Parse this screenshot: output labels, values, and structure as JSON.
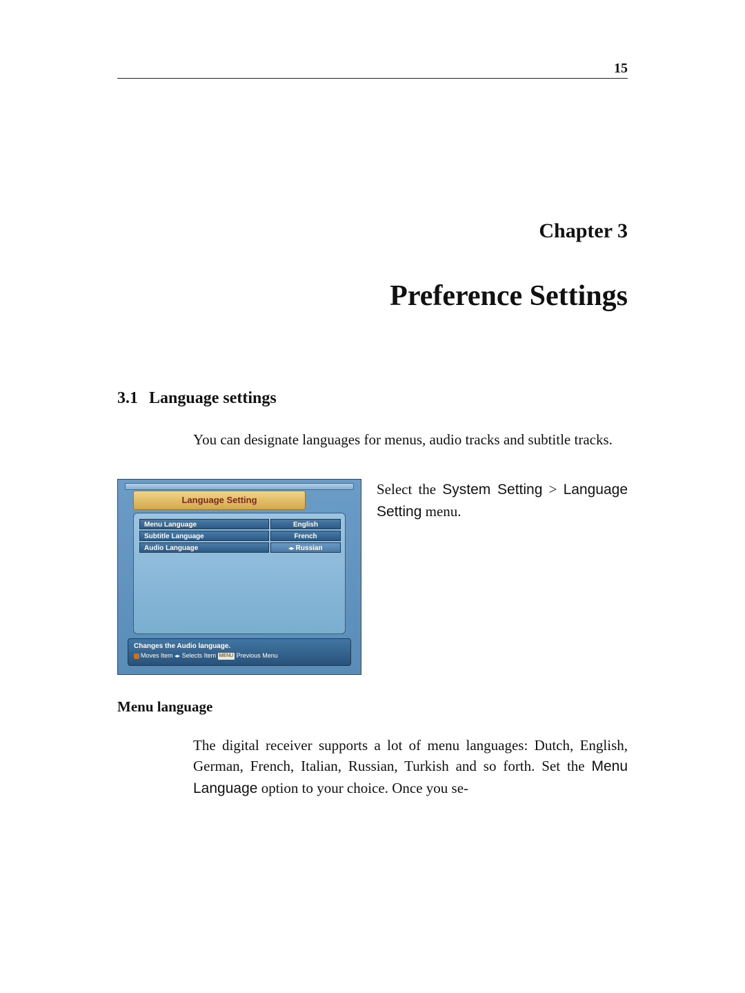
{
  "page_number": "15",
  "chapter_label": "Chapter 3",
  "chapter_title": "Preference Settings",
  "section": {
    "number": "3.1",
    "title": "Language settings"
  },
  "intro_paragraph": "You can designate languages for menus, audio tracks and subtitle tracks.",
  "screenshot": {
    "title": "Language Setting",
    "rows": [
      {
        "label": "Menu Language",
        "value": "English"
      },
      {
        "label": "Subtitle Language",
        "value": "French"
      },
      {
        "label": "Audio Language",
        "value": "Russian",
        "selected": true
      }
    ],
    "footer_hint1": "Changes the Audio language.",
    "footer_hint2_moves": "Moves Item",
    "footer_hint2_selects": "Selects Item",
    "footer_hint2_menu_badge": "MENU",
    "footer_hint2_prev": "Previous Menu"
  },
  "side_text": {
    "part1": "Select the ",
    "part2_sans": "System Setting",
    "part3": " > ",
    "part4_sans": "Language Setting",
    "part5": " menu."
  },
  "subsection_heading": "Menu language",
  "body_paragraph": {
    "p1": "The digital receiver supports a lot of menu languages: Dutch, English, German, French, Italian, Russian, Turkish and so forth. Set the ",
    "p2_sans": "Menu Language",
    "p3": " option to your choice. Once you se-"
  }
}
